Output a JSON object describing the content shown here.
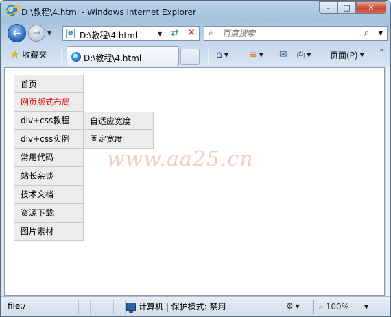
{
  "window": {
    "title": "D:\\教程\\4.html - Windows Internet Explorer"
  },
  "caption": {
    "minimize": "–",
    "maximize": "□",
    "close": "✕"
  },
  "address": {
    "url": "D:\\教程\\4.html"
  },
  "search": {
    "placeholder": "百度搜索"
  },
  "favorites": {
    "label": "收藏夹"
  },
  "tab": {
    "label": "D:\\教程\\4.html"
  },
  "commands": {
    "page_label": "页面(P)"
  },
  "page": {
    "menu": [
      {
        "label": "首页",
        "active": false
      },
      {
        "label": "网页版式布局",
        "active": true
      },
      {
        "label": "div+css教程",
        "active": false
      },
      {
        "label": "div+css实例",
        "active": false
      },
      {
        "label": "常用代码",
        "active": false
      },
      {
        "label": "站长杂谈",
        "active": false
      },
      {
        "label": "技术文档",
        "active": false
      },
      {
        "label": "资源下载",
        "active": false
      },
      {
        "label": "图片素材",
        "active": false
      }
    ],
    "submenu": [
      {
        "label": "自适应宽度"
      },
      {
        "label": "固定宽度"
      }
    ],
    "watermark": "www.aa25.cn",
    "accent_color": "#e01010"
  },
  "status": {
    "text": "file:/",
    "zone": "计算机 | 保护模式: 禁用",
    "zoom": "100%"
  },
  "icons": {
    "back": "back-arrow-icon",
    "forward": "forward-arrow-icon",
    "refresh": "refresh-icon",
    "stop": "stop-icon",
    "search": "search-icon",
    "favorites": "star-icon",
    "home": "home-icon",
    "feeds": "rss-icon",
    "mail": "mail-icon",
    "print": "printer-icon"
  }
}
